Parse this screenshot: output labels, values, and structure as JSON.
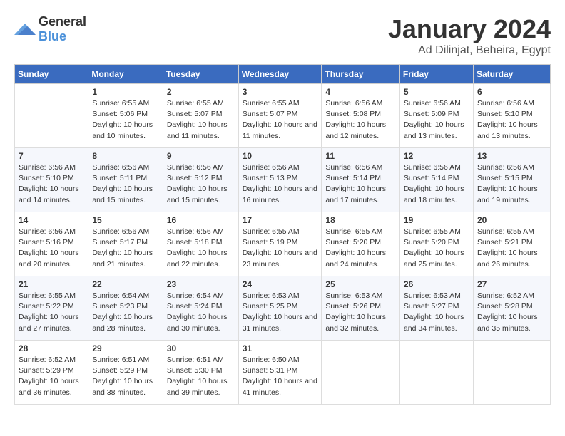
{
  "header": {
    "logo": {
      "general": "General",
      "blue": "Blue"
    },
    "title": "January 2024",
    "location": "Ad Dilinjat, Beheira, Egypt"
  },
  "calendar": {
    "days": [
      "Sunday",
      "Monday",
      "Tuesday",
      "Wednesday",
      "Thursday",
      "Friday",
      "Saturday"
    ],
    "weeks": [
      [
        {
          "date": "",
          "sunrise": "",
          "sunset": "",
          "daylight": ""
        },
        {
          "date": "1",
          "sunrise": "Sunrise: 6:55 AM",
          "sunset": "Sunset: 5:06 PM",
          "daylight": "Daylight: 10 hours and 10 minutes."
        },
        {
          "date": "2",
          "sunrise": "Sunrise: 6:55 AM",
          "sunset": "Sunset: 5:07 PM",
          "daylight": "Daylight: 10 hours and 11 minutes."
        },
        {
          "date": "3",
          "sunrise": "Sunrise: 6:55 AM",
          "sunset": "Sunset: 5:07 PM",
          "daylight": "Daylight: 10 hours and 11 minutes."
        },
        {
          "date": "4",
          "sunrise": "Sunrise: 6:56 AM",
          "sunset": "Sunset: 5:08 PM",
          "daylight": "Daylight: 10 hours and 12 minutes."
        },
        {
          "date": "5",
          "sunrise": "Sunrise: 6:56 AM",
          "sunset": "Sunset: 5:09 PM",
          "daylight": "Daylight: 10 hours and 13 minutes."
        },
        {
          "date": "6",
          "sunrise": "Sunrise: 6:56 AM",
          "sunset": "Sunset: 5:10 PM",
          "daylight": "Daylight: 10 hours and 13 minutes."
        }
      ],
      [
        {
          "date": "7",
          "sunrise": "Sunrise: 6:56 AM",
          "sunset": "Sunset: 5:10 PM",
          "daylight": "Daylight: 10 hours and 14 minutes."
        },
        {
          "date": "8",
          "sunrise": "Sunrise: 6:56 AM",
          "sunset": "Sunset: 5:11 PM",
          "daylight": "Daylight: 10 hours and 15 minutes."
        },
        {
          "date": "9",
          "sunrise": "Sunrise: 6:56 AM",
          "sunset": "Sunset: 5:12 PM",
          "daylight": "Daylight: 10 hours and 15 minutes."
        },
        {
          "date": "10",
          "sunrise": "Sunrise: 6:56 AM",
          "sunset": "Sunset: 5:13 PM",
          "daylight": "Daylight: 10 hours and 16 minutes."
        },
        {
          "date": "11",
          "sunrise": "Sunrise: 6:56 AM",
          "sunset": "Sunset: 5:14 PM",
          "daylight": "Daylight: 10 hours and 17 minutes."
        },
        {
          "date": "12",
          "sunrise": "Sunrise: 6:56 AM",
          "sunset": "Sunset: 5:14 PM",
          "daylight": "Daylight: 10 hours and 18 minutes."
        },
        {
          "date": "13",
          "sunrise": "Sunrise: 6:56 AM",
          "sunset": "Sunset: 5:15 PM",
          "daylight": "Daylight: 10 hours and 19 minutes."
        }
      ],
      [
        {
          "date": "14",
          "sunrise": "Sunrise: 6:56 AM",
          "sunset": "Sunset: 5:16 PM",
          "daylight": "Daylight: 10 hours and 20 minutes."
        },
        {
          "date": "15",
          "sunrise": "Sunrise: 6:56 AM",
          "sunset": "Sunset: 5:17 PM",
          "daylight": "Daylight: 10 hours and 21 minutes."
        },
        {
          "date": "16",
          "sunrise": "Sunrise: 6:56 AM",
          "sunset": "Sunset: 5:18 PM",
          "daylight": "Daylight: 10 hours and 22 minutes."
        },
        {
          "date": "17",
          "sunrise": "Sunrise: 6:55 AM",
          "sunset": "Sunset: 5:19 PM",
          "daylight": "Daylight: 10 hours and 23 minutes."
        },
        {
          "date": "18",
          "sunrise": "Sunrise: 6:55 AM",
          "sunset": "Sunset: 5:20 PM",
          "daylight": "Daylight: 10 hours and 24 minutes."
        },
        {
          "date": "19",
          "sunrise": "Sunrise: 6:55 AM",
          "sunset": "Sunset: 5:20 PM",
          "daylight": "Daylight: 10 hours and 25 minutes."
        },
        {
          "date": "20",
          "sunrise": "Sunrise: 6:55 AM",
          "sunset": "Sunset: 5:21 PM",
          "daylight": "Daylight: 10 hours and 26 minutes."
        }
      ],
      [
        {
          "date": "21",
          "sunrise": "Sunrise: 6:55 AM",
          "sunset": "Sunset: 5:22 PM",
          "daylight": "Daylight: 10 hours and 27 minutes."
        },
        {
          "date": "22",
          "sunrise": "Sunrise: 6:54 AM",
          "sunset": "Sunset: 5:23 PM",
          "daylight": "Daylight: 10 hours and 28 minutes."
        },
        {
          "date": "23",
          "sunrise": "Sunrise: 6:54 AM",
          "sunset": "Sunset: 5:24 PM",
          "daylight": "Daylight: 10 hours and 30 minutes."
        },
        {
          "date": "24",
          "sunrise": "Sunrise: 6:53 AM",
          "sunset": "Sunset: 5:25 PM",
          "daylight": "Daylight: 10 hours and 31 minutes."
        },
        {
          "date": "25",
          "sunrise": "Sunrise: 6:53 AM",
          "sunset": "Sunset: 5:26 PM",
          "daylight": "Daylight: 10 hours and 32 minutes."
        },
        {
          "date": "26",
          "sunrise": "Sunrise: 6:53 AM",
          "sunset": "Sunset: 5:27 PM",
          "daylight": "Daylight: 10 hours and 34 minutes."
        },
        {
          "date": "27",
          "sunrise": "Sunrise: 6:52 AM",
          "sunset": "Sunset: 5:28 PM",
          "daylight": "Daylight: 10 hours and 35 minutes."
        }
      ],
      [
        {
          "date": "28",
          "sunrise": "Sunrise: 6:52 AM",
          "sunset": "Sunset: 5:29 PM",
          "daylight": "Daylight: 10 hours and 36 minutes."
        },
        {
          "date": "29",
          "sunrise": "Sunrise: 6:51 AM",
          "sunset": "Sunset: 5:29 PM",
          "daylight": "Daylight: 10 hours and 38 minutes."
        },
        {
          "date": "30",
          "sunrise": "Sunrise: 6:51 AM",
          "sunset": "Sunset: 5:30 PM",
          "daylight": "Daylight: 10 hours and 39 minutes."
        },
        {
          "date": "31",
          "sunrise": "Sunrise: 6:50 AM",
          "sunset": "Sunset: 5:31 PM",
          "daylight": "Daylight: 10 hours and 41 minutes."
        },
        {
          "date": "",
          "sunrise": "",
          "sunset": "",
          "daylight": ""
        },
        {
          "date": "",
          "sunrise": "",
          "sunset": "",
          "daylight": ""
        },
        {
          "date": "",
          "sunrise": "",
          "sunset": "",
          "daylight": ""
        }
      ]
    ]
  }
}
